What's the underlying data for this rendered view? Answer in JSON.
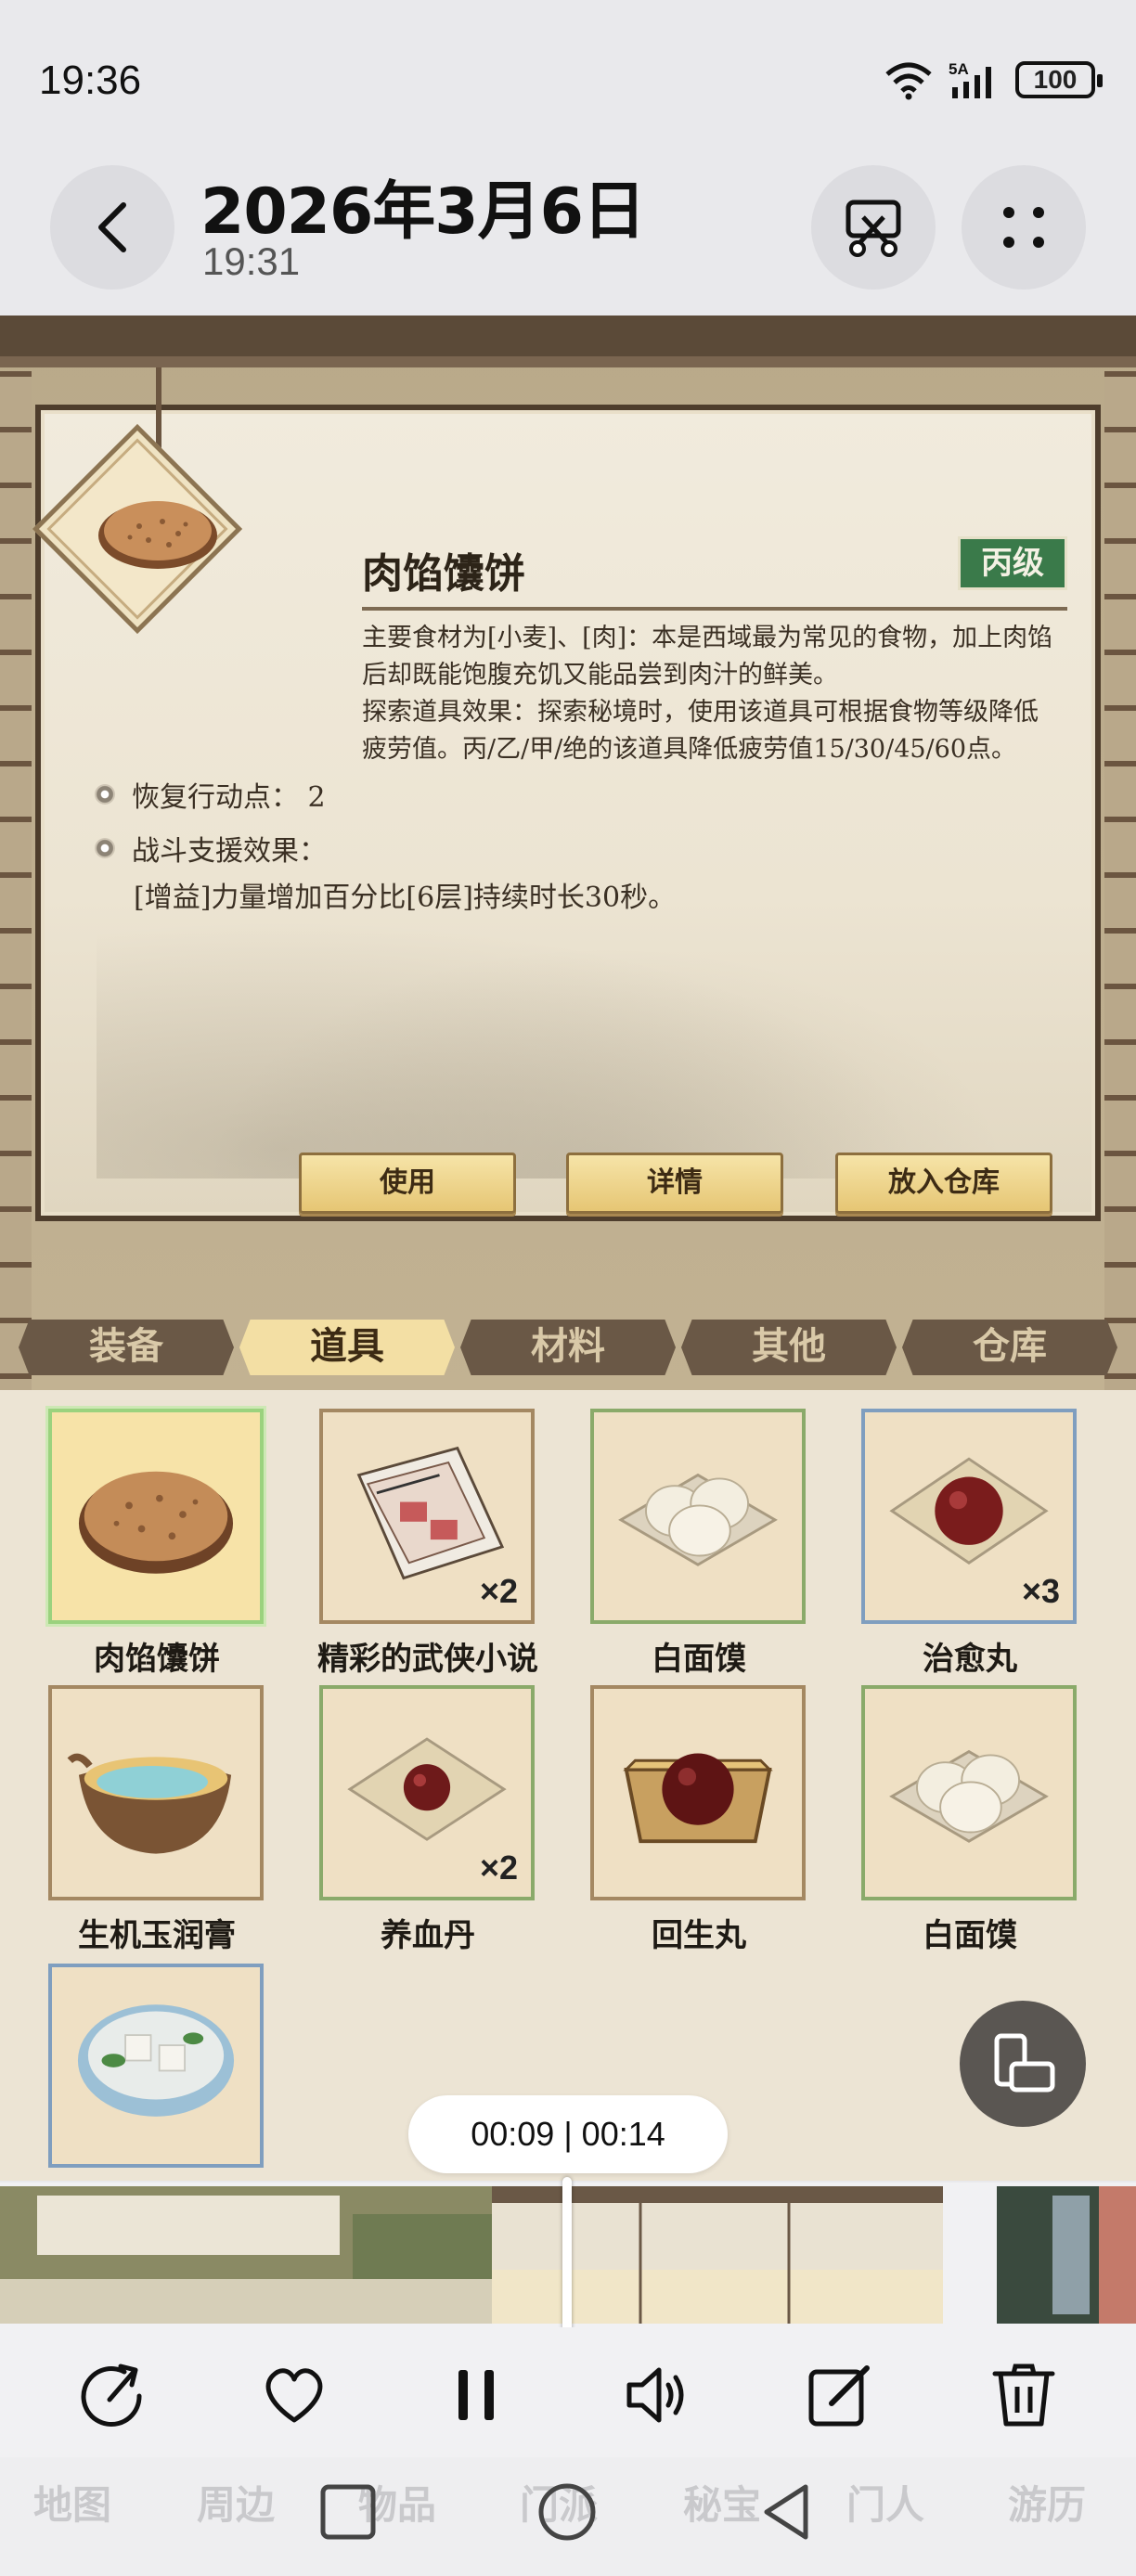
{
  "status_bar": {
    "time": "19:36",
    "signal_label": "5A",
    "battery": "100"
  },
  "header": {
    "title": "2026年3月6日",
    "subtitle": "19:31",
    "back_icon": "chevron-left-icon",
    "cut_icon": "scissors-icon",
    "more_icon": "dots-grid-icon"
  },
  "game": {
    "item": {
      "name": "肉馅馕饼",
      "grade": "丙级",
      "description_lines": [
        "主要食材为[小麦]、[肉]：本是西域最为常见的食物，加上肉馅",
        "后却既能饱腹充饥又能品尝到肉汁的鲜美。",
        "探索道具效果：探索秘境时，使用该道具可根据食物等级降低",
        "疲劳值。丙/乙/甲/绝的该道具降低疲劳值15/30/45/60点。"
      ],
      "attr_1": "恢复行动点： 2",
      "attr_2": "战斗支援效果：",
      "attr_2_detail": "[增益]力量增加百分比[6层]持续时长30秒。"
    },
    "actions": {
      "use": "使用",
      "details": "详情",
      "store": "放入仓库"
    },
    "tabs": [
      "装备",
      "道具",
      "材料",
      "其他",
      "仓库"
    ],
    "active_tab": "道具",
    "inventory": [
      {
        "label": "肉馅馕饼",
        "count": ""
      },
      {
        "label": "精彩的武侠小说",
        "count": "×2"
      },
      {
        "label": "白面馍",
        "count": ""
      },
      {
        "label": "治愈丸",
        "count": "×3"
      },
      {
        "label": "生机玉润膏",
        "count": ""
      },
      {
        "label": "养血丹",
        "count": "×2"
      },
      {
        "label": "回生丸",
        "count": ""
      },
      {
        "label": "白面馍",
        "count": ""
      },
      {
        "label": "",
        "count": ""
      }
    ]
  },
  "player": {
    "time_display": "00:09 | 00:14",
    "progress": 0.643
  },
  "toolbar": {
    "share_icon": "share-icon",
    "favorite_icon": "heart-icon",
    "pause_icon": "pause-icon",
    "volume_icon": "volume-icon",
    "edit_icon": "edit-icon",
    "delete_icon": "trash-icon"
  },
  "background_nav": [
    "地图",
    "周边",
    "物品",
    "门派",
    "秘宝",
    "门人",
    "游历"
  ],
  "colors": {
    "grade_badge": "#3a7a4a",
    "active_tab": "#f3dfa4",
    "inactive_tab": "#6a5846",
    "selected_slot_border": "#9bd27e"
  }
}
